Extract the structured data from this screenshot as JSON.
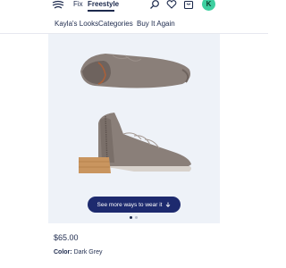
{
  "header": {
    "tabs": [
      {
        "label": "Fix"
      },
      {
        "label": "Freestyle"
      }
    ],
    "avatar_initial": "K",
    "avatar_color": "#3ecfa0"
  },
  "subnav": {
    "items": [
      {
        "label": "Kayla's Looks"
      },
      {
        "label": "Categories"
      },
      {
        "label": "Buy It Again"
      }
    ]
  },
  "product": {
    "carousel_button_label": "See more ways to wear it",
    "carousel_pages": 2,
    "carousel_active_page": 1,
    "price": "$65.00",
    "color_label": "Color:",
    "color_value": "Dark Grey"
  },
  "colors": {
    "brand_navy": "#1d2a6e",
    "panel_bg": "#eef2f8",
    "boot_grey": "#8a7f79",
    "heel_tan": "#c9955f"
  }
}
